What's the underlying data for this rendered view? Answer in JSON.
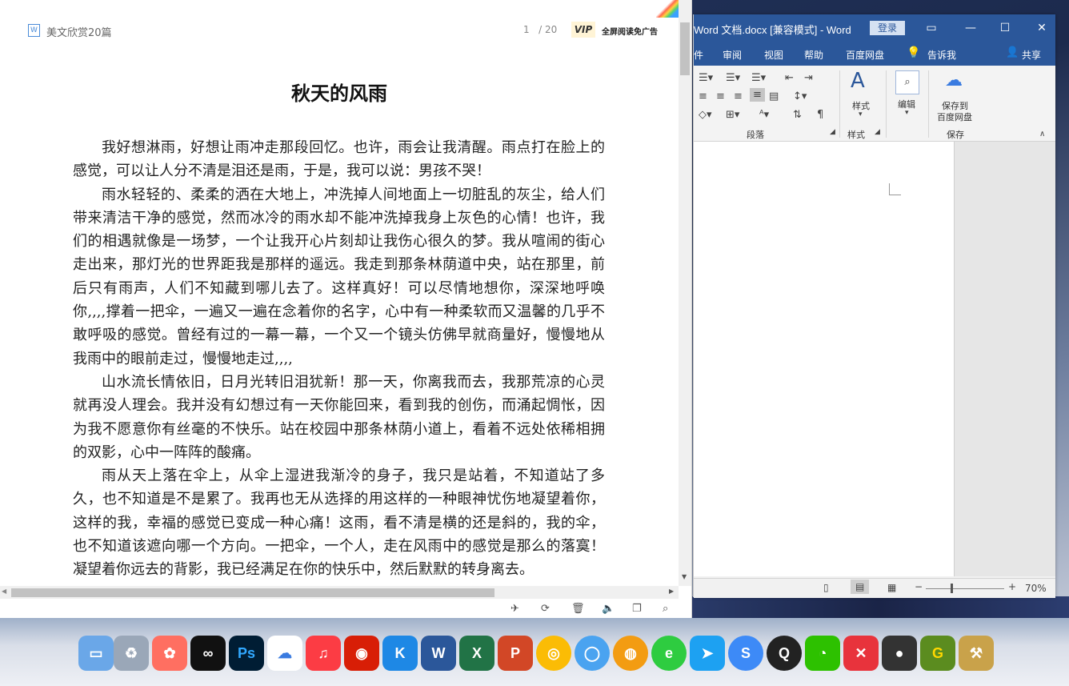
{
  "reader": {
    "doc_name": "美文欣赏20篇",
    "file_icon": "W",
    "page_current": "1",
    "page_total": "/ 20",
    "vip_badge": "VIP",
    "vip_text": "全屏阅读免广告",
    "title": "秋天的风雨",
    "paragraphs": [
      "我好想淋雨，好想让雨冲走那段回忆。也许，雨会让我清醒。雨点打在脸上的感觉，可以让人分不清是泪还是雨，于是，我可以说：男孩不哭！",
      "雨水轻轻的、柔柔的洒在大地上，冲洗掉人间地面上一切脏乱的灰尘，给人们带来清洁干净的感觉，然而冰冷的雨水却不能冲洗掉我身上灰色的心情！也许，我们的相遇就像是一场梦，一个让我开心片刻却让我伤心很久的梦。我从喧闹的街心走出来，那灯光的世界距我是那样的遥远。我走到那条林荫道中央，站在那里，前后只有雨声，人们不知藏到哪儿去了。这样真好！可以尽情地想你，深深地呼唤你,,,,撑着一把伞，一遍又一遍在念着你的名字，心中有一种柔软而又温馨的几乎不敢呼吸的感觉。曾经有过的一幕一幕，一个又一个镜头仿佛早就商量好，慢慢地从我雨中的眼前走过，慢慢地走过,,,,",
      "山水流长情依旧，日月光转旧泪犹新！那一天，你离我而去，我那荒凉的心灵就再没人理会。我并没有幻想过有一天你能回来，看到我的创伤，而涌起惆怅，因为我不愿意你有丝毫的不快乐。站在校园中那条林荫小道上，看着不远处依稀相拥的双影，心中一阵阵的酸痛。",
      "雨从天上落在伞上，从伞上湿进我渐冷的身子，我只是站着，不知道站了多久，也不知道是不是累了。我再也无从选择的用这样的一种眼神忧伤地凝望着你，这样的我，幸福的感觉已变成一种心痛！这雨，看不清是横的还是斜的，我的伞，也不知道该遮向哪一个方向。一把伞，一个人，走在风雨中的感觉是那么的落寞！凝望着你远去的背影，我已经满足在你的快乐中，然后默默的转身离去。"
    ]
  },
  "word": {
    "title": "Word 文档.docx [兼容模式] - Word",
    "login": "登录",
    "menu": [
      "件",
      "审阅",
      "视图",
      "帮助",
      "百度网盘",
      "告诉我",
      "共享"
    ],
    "ribbon": {
      "paragraph_group": "段落",
      "style_label": "样式",
      "style_group": "样式",
      "edit_label": "编辑",
      "save_label_1": "保存到",
      "save_label_2": "百度网盘",
      "save_group": "保存"
    },
    "zoom": "70%"
  },
  "taskbar": {
    "apps": [
      "计算机",
      "回收站",
      "Google相册",
      "抖音",
      "Photoshop",
      "百度网盘",
      "音乐",
      "网易云音乐",
      "酷狗音乐",
      "Word",
      "Excel",
      "PowerPoint",
      "Chrome",
      "浏览器",
      "360浏览器",
      "IE浏览器",
      "飞书",
      "搜狗",
      "QQ",
      "微信",
      "XMind",
      "录屏",
      "Greenshot",
      "工具"
    ]
  },
  "colors": {
    "word_blue": "#2b579a",
    "page_bg": "#ffffff"
  }
}
